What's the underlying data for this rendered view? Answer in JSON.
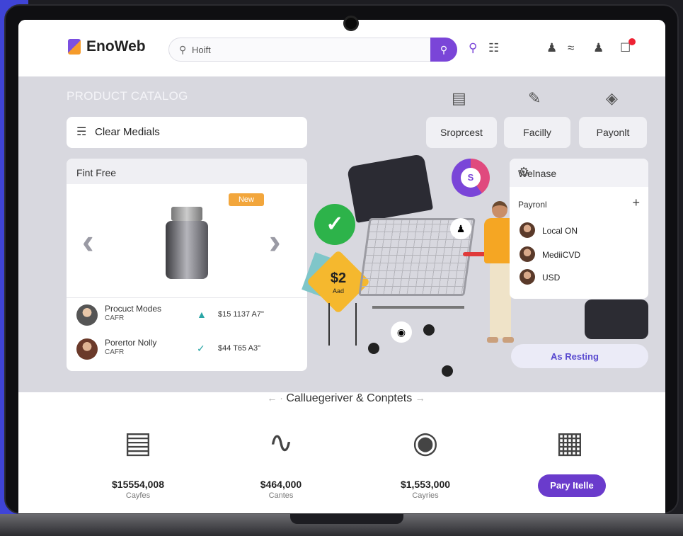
{
  "header": {
    "logo_text": "EnoWeb",
    "search_value": "Hoift",
    "search_icon": "search-icon",
    "icons": [
      "search-icon",
      "map-icon",
      "user-icon",
      "wifi-icon",
      "account-icon",
      "cart-icon"
    ]
  },
  "catalog": {
    "title": "PRODUCT CATALOG",
    "filter_label": "Clear Medials",
    "tabs": [
      "Sroprcest",
      "Facilly",
      "Payonlt"
    ]
  },
  "product_card": {
    "header": "Fint Free",
    "tag": "New",
    "rows": [
      {
        "name": "Procuct Modes",
        "sub": "CAFR",
        "price": "$15 1137 A7\""
      },
      {
        "name": "Porertor Nolly",
        "sub": "CAFR",
        "price": "$44 T65 A3\""
      }
    ]
  },
  "illustration": {
    "price_value": "$2",
    "price_sub": "Aad",
    "pie_label": "S"
  },
  "right_panel": {
    "title": "Welnase",
    "section_label": "Payronl",
    "items": [
      "Local ON",
      "MediiCVD",
      "USD"
    ]
  },
  "rating_select": {
    "value": "As Resting"
  },
  "bottom": {
    "section_title": "Calluegeriver & Conptets",
    "stats": [
      {
        "value": "$15554,008",
        "label": "Cayfes"
      },
      {
        "value": "$464,000",
        "label": "Cantes"
      },
      {
        "value": "$1,553,000",
        "label": "Cayries"
      }
    ],
    "pay_button": "Pary Itelle"
  },
  "colors": {
    "accent": "#7a45d8",
    "page_bg": "#3f44d6",
    "success": "#2db34a",
    "tag": "#f2a63c"
  }
}
